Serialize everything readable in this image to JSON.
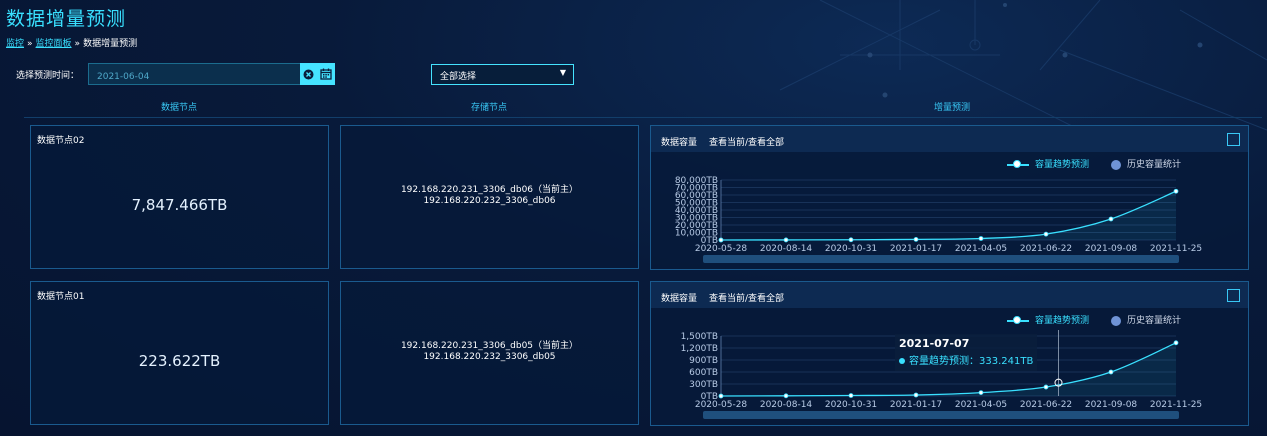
{
  "page": {
    "title": "数据增量预测"
  },
  "breadcrumb": {
    "item1": "监控",
    "item2": "监控面板",
    "current": "数据增量预测",
    "sep": "»"
  },
  "filter": {
    "label": "选择预测时间：",
    "date_value": "2021-06-04",
    "select_value": "全部选择"
  },
  "columns": {
    "data_node": "数据节点",
    "storage_node": "存储节点",
    "forecast": "增量预测"
  },
  "rows": [
    {
      "node_name": "数据节点02",
      "value": "7,847.466TB",
      "storage_lines": [
        "192.168.220.231_3306_db06（当前主）",
        "192.168.220.232_3306_db06"
      ],
      "chart_title": "数据容量",
      "chart_links": "查看当前/查看全部"
    },
    {
      "node_name": "数据节点01",
      "value": "223.622TB",
      "storage_lines": [
        "192.168.220.231_3306_db05（当前主）",
        "192.168.220.232_3306_db05"
      ],
      "chart_title": "数据容量",
      "chart_links": "查看当前/查看全部",
      "tooltip": {
        "date": "2021-07-07",
        "text": "容量趋势预测：333.241TB"
      }
    }
  ],
  "legend": {
    "trend": "容量趋势预测",
    "history": "历史容量统计"
  },
  "colors": {
    "accent": "#39e0ff",
    "history": "#6f93d6",
    "background": "#071a3b"
  },
  "chart_data": [
    {
      "type": "line",
      "x_labels": [
        "2020-05-28",
        "2020-08-14",
        "2020-10-31",
        "2021-01-17",
        "2021-04-05",
        "2021-06-22",
        "2021-09-08",
        "2021-11-25"
      ],
      "y_ticks": [
        "0TB",
        "10,000TB",
        "20,000TB",
        "30,000TB",
        "40,000TB",
        "50,000TB",
        "60,000TB",
        "70,000TB",
        "80,000TB"
      ],
      "ylim": [
        0,
        80000
      ],
      "series": [
        {
          "name": "容量趋势预测",
          "values": [
            0,
            100,
            300,
            800,
            2000,
            7800,
            28000,
            65000
          ]
        },
        {
          "name": "历史容量统计",
          "values": []
        }
      ],
      "grid": true,
      "legend_position": "top-right"
    },
    {
      "type": "line",
      "x_labels": [
        "2020-05-28",
        "2020-08-14",
        "2020-10-31",
        "2021-01-17",
        "2021-04-05",
        "2021-06-22",
        "2021-09-08",
        "2021-11-25"
      ],
      "y_ticks": [
        "0TB",
        "300TB",
        "600TB",
        "900TB",
        "1,200TB",
        "1,500TB"
      ],
      "ylim": [
        0,
        1500
      ],
      "series": [
        {
          "name": "容量趋势预测",
          "values": [
            0,
            5,
            12,
            25,
            85,
            224,
            600,
            1330
          ]
        },
        {
          "name": "历史容量统计",
          "values": []
        }
      ],
      "highlight": {
        "x": "2021-07-07",
        "y": 333.241
      },
      "grid": true,
      "legend_position": "top-right"
    }
  ]
}
